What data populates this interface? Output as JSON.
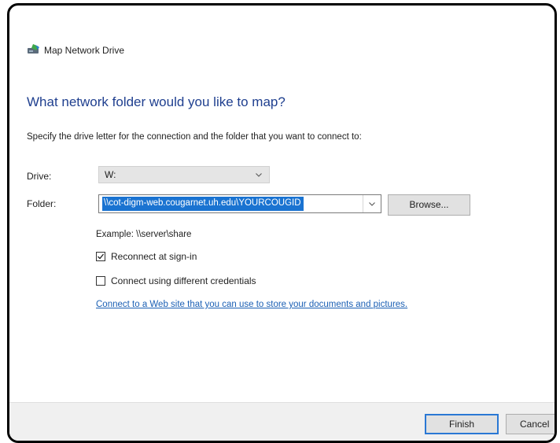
{
  "window": {
    "title": "Map Network Drive",
    "icon": "network-drive-icon"
  },
  "content": {
    "heading": "What network folder would you like to map?",
    "instructions": "Specify the drive letter for the connection and the folder that you want to connect to:",
    "drive_label": "Drive:",
    "drive_value": "W:",
    "folder_label": "Folder:",
    "folder_value": "\\\\cot-digm-web.cougarnet.uh.edu\\YOURCOUGID",
    "browse_label": "Browse...",
    "example_text": "Example: \\\\server\\share",
    "reconnect": {
      "label": "Reconnect at sign-in",
      "checked": true
    },
    "different_credentials": {
      "label": "Connect using different credentials",
      "checked": false
    },
    "link_text": "Connect to a Web site that you can use to store your documents and pictures."
  },
  "footer": {
    "finish_label": "Finish",
    "cancel_label": "Cancel"
  },
  "colors": {
    "heading": "#1f3f8f",
    "selection": "#1a73d1",
    "link": "#1a5fb4",
    "default_button_border": "#2a78d4"
  }
}
